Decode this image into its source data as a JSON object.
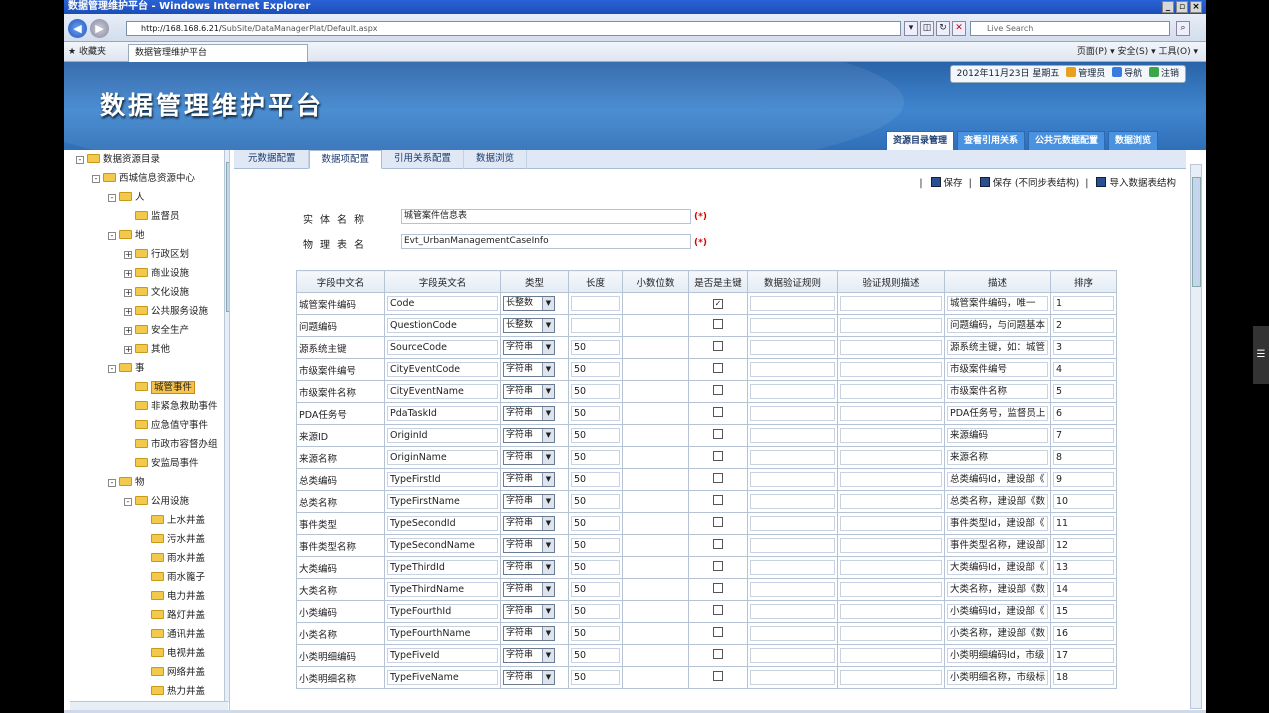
{
  "browser": {
    "title": "数据管理维护平台 - Windows Internet Explorer",
    "url_host": "http://168.168.6.21/",
    "url_path": "SubSite/DataManagerPlat/Default.aspx",
    "search_placeholder": "Live Search",
    "favorites_label": "收藏夹",
    "tab_title": "数据管理维护平台",
    "tools": "页面(P) ▾  安全(S) ▾  工具(O) ▾"
  },
  "header": {
    "logo": "数据管理维护平台",
    "date": "2012年11月23日 星期五",
    "user": "管理员",
    "nav_link": "导航",
    "logout": "注销",
    "tabs": [
      "资源目录管理",
      "查看引用关系",
      "公共元数据配置",
      "数据浏览"
    ]
  },
  "tree": [
    {
      "label": "数据资源目录",
      "level": 0,
      "pm": "-"
    },
    {
      "label": "西城信息资源中心",
      "level": 1,
      "pm": "-"
    },
    {
      "label": "人",
      "level": 2,
      "pm": "-"
    },
    {
      "label": "监督员",
      "level": 3,
      "pm": ""
    },
    {
      "label": "地",
      "level": 2,
      "pm": "-"
    },
    {
      "label": "行政区划",
      "level": 3,
      "pm": "+"
    },
    {
      "label": "商业设施",
      "level": 3,
      "pm": "+"
    },
    {
      "label": "文化设施",
      "level": 3,
      "pm": "+"
    },
    {
      "label": "公共服务设施",
      "level": 3,
      "pm": "+"
    },
    {
      "label": "安全生产",
      "level": 3,
      "pm": "+"
    },
    {
      "label": "其他",
      "level": 3,
      "pm": "+"
    },
    {
      "label": "事",
      "level": 2,
      "pm": "-"
    },
    {
      "label": "城管事件",
      "level": 3,
      "pm": "",
      "selected": true
    },
    {
      "label": "非紧急救助事件",
      "level": 3,
      "pm": ""
    },
    {
      "label": "应急值守事件",
      "level": 3,
      "pm": ""
    },
    {
      "label": "市政市容督办组",
      "level": 3,
      "pm": ""
    },
    {
      "label": "安监局事件",
      "level": 3,
      "pm": ""
    },
    {
      "label": "物",
      "level": 2,
      "pm": "-"
    },
    {
      "label": "公用设施",
      "level": 3,
      "pm": "-"
    },
    {
      "label": "上水井盖",
      "level": 4,
      "pm": ""
    },
    {
      "label": "污水井盖",
      "level": 4,
      "pm": ""
    },
    {
      "label": "雨水井盖",
      "level": 4,
      "pm": ""
    },
    {
      "label": "雨水篦子",
      "level": 4,
      "pm": ""
    },
    {
      "label": "电力井盖",
      "level": 4,
      "pm": ""
    },
    {
      "label": "路灯井盖",
      "level": 4,
      "pm": ""
    },
    {
      "label": "通讯井盖",
      "level": 4,
      "pm": ""
    },
    {
      "label": "电视井盖",
      "level": 4,
      "pm": ""
    },
    {
      "label": "网络井盖",
      "level": 4,
      "pm": ""
    },
    {
      "label": "热力井盖",
      "level": 4,
      "pm": ""
    }
  ],
  "subtabs": [
    "元数据配置",
    "数据项配置",
    "引用关系配置",
    "数据浏览"
  ],
  "toolbar": {
    "save": "保存",
    "save_nosync": "保存 (不同步表结构)",
    "import": "导入数据表结构"
  },
  "form": {
    "entity_label": "实体名称",
    "entity_value": "城管案件信息表",
    "table_label": "物理表名",
    "table_value": "Evt_UrbanManagementCaseInfo",
    "required": "(*)"
  },
  "columns": [
    "字段中文名",
    "字段英文名",
    "类型",
    "长度",
    "小数位数",
    "是否是主键",
    "数据验证规则",
    "验证规则描述",
    "描述",
    "排序"
  ],
  "rows": [
    {
      "cn": "城管案件编码",
      "en": "Code",
      "type": "长整数",
      "len": "",
      "pk": true,
      "desc": "城管案件编码，唯一",
      "order": "1"
    },
    {
      "cn": "问题编码",
      "en": "QuestionCode",
      "type": "长整数",
      "len": "",
      "pk": false,
      "desc": "问题编码，与问题基本",
      "order": "2"
    },
    {
      "cn": "源系统主键",
      "en": "SourceCode",
      "type": "字符串",
      "len": "50",
      "pk": false,
      "desc": "源系统主键，如：城管",
      "order": "3"
    },
    {
      "cn": "市级案件编号",
      "en": "CityEventCode",
      "type": "字符串",
      "len": "50",
      "pk": false,
      "desc": "市级案件编号",
      "order": "4"
    },
    {
      "cn": "市级案件名称",
      "en": "CityEventName",
      "type": "字符串",
      "len": "50",
      "pk": false,
      "desc": "市级案件名称",
      "order": "5"
    },
    {
      "cn": "PDA任务号",
      "en": "PdaTaskId",
      "type": "字符串",
      "len": "50",
      "pk": false,
      "desc": "PDA任务号，监督员上",
      "order": "6"
    },
    {
      "cn": "来源ID",
      "en": "OriginId",
      "type": "字符串",
      "len": "50",
      "pk": false,
      "desc": "来源编码",
      "order": "7"
    },
    {
      "cn": "来源名称",
      "en": "OriginName",
      "type": "字符串",
      "len": "50",
      "pk": false,
      "desc": "来源名称",
      "order": "8"
    },
    {
      "cn": "总类编码",
      "en": "TypeFirstId",
      "type": "字符串",
      "len": "50",
      "pk": false,
      "desc": "总类编码Id，建设部《",
      "order": "9"
    },
    {
      "cn": "总类名称",
      "en": "TypeFirstName",
      "type": "字符串",
      "len": "50",
      "pk": false,
      "desc": "总类名称，建设部《数",
      "order": "10"
    },
    {
      "cn": "事件类型",
      "en": "TypeSecondId",
      "type": "字符串",
      "len": "50",
      "pk": false,
      "desc": "事件类型Id，建设部《",
      "order": "11"
    },
    {
      "cn": "事件类型名称",
      "en": "TypeSecondName",
      "type": "字符串",
      "len": "50",
      "pk": false,
      "desc": "事件类型名称，建设部",
      "order": "12"
    },
    {
      "cn": "大类编码",
      "en": "TypeThirdId",
      "type": "字符串",
      "len": "50",
      "pk": false,
      "desc": "大类编码Id，建设部《",
      "order": "13"
    },
    {
      "cn": "大类名称",
      "en": "TypeThirdName",
      "type": "字符串",
      "len": "50",
      "pk": false,
      "desc": "大类名称，建设部《数",
      "order": "14"
    },
    {
      "cn": "小类编码",
      "en": "TypeFourthId",
      "type": "字符串",
      "len": "50",
      "pk": false,
      "desc": "小类编码Id，建设部《",
      "order": "15"
    },
    {
      "cn": "小类名称",
      "en": "TypeFourthName",
      "type": "字符串",
      "len": "50",
      "pk": false,
      "desc": "小类名称，建设部《数",
      "order": "16"
    },
    {
      "cn": "小类明细编码",
      "en": "TypeFiveId",
      "type": "字符串",
      "len": "50",
      "pk": false,
      "desc": "小类明细编码Id，市级",
      "order": "17"
    },
    {
      "cn": "小类明细名称",
      "en": "TypeFiveName",
      "type": "字符串",
      "len": "50",
      "pk": false,
      "desc": "小类明细名称，市级标",
      "order": "18"
    }
  ]
}
